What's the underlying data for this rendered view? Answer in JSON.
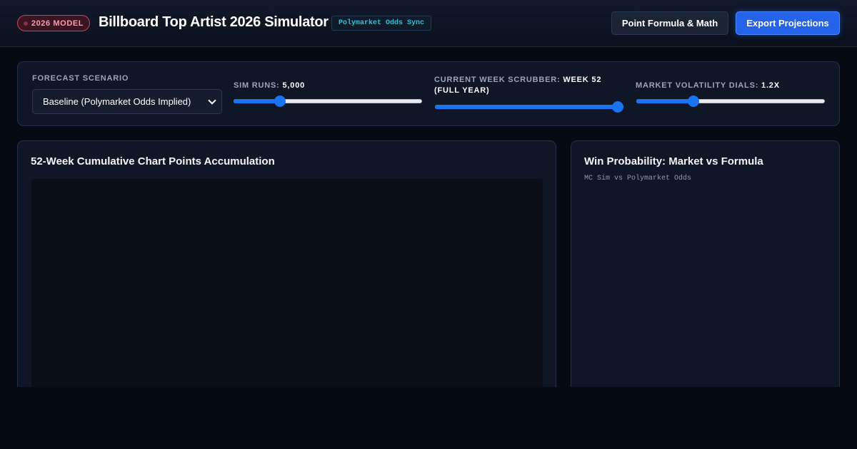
{
  "header": {
    "badge_label": "2026 MODEL",
    "title": "Billboard Top Artist 2026 Simulator",
    "sync_chip": "Polymarket Odds Sync",
    "formula_button": "Point Formula & Math",
    "export_button": "Export Projections"
  },
  "controls": {
    "scenario": {
      "label": "FORECAST SCENARIO",
      "selected": "Baseline (Polymarket Odds Implied)"
    },
    "sim_runs": {
      "label": "SIM RUNS: ",
      "value": "5,000",
      "level": 0.23
    },
    "week_scrubber": {
      "label": "CURRENT WEEK SCRUBBER: ",
      "value": "WEEK 52 (FULL YEAR)",
      "level": 1.0
    },
    "volatility": {
      "label": "MARKET VOLATILITY DIALS: ",
      "value": "1.2X",
      "level": 0.29
    }
  },
  "cards": {
    "accumulation": {
      "title": "52-Week Cumulative Chart Points Accumulation"
    },
    "win_probability": {
      "title": "Win Probability: Market vs Formula",
      "subtitle": "MC Sim vs Polymarket Odds"
    }
  },
  "colors": {
    "accent": "#2563eb",
    "slider": "#1a73f0",
    "badge": "#d1425a",
    "sync": "#2bc3d8"
  }
}
